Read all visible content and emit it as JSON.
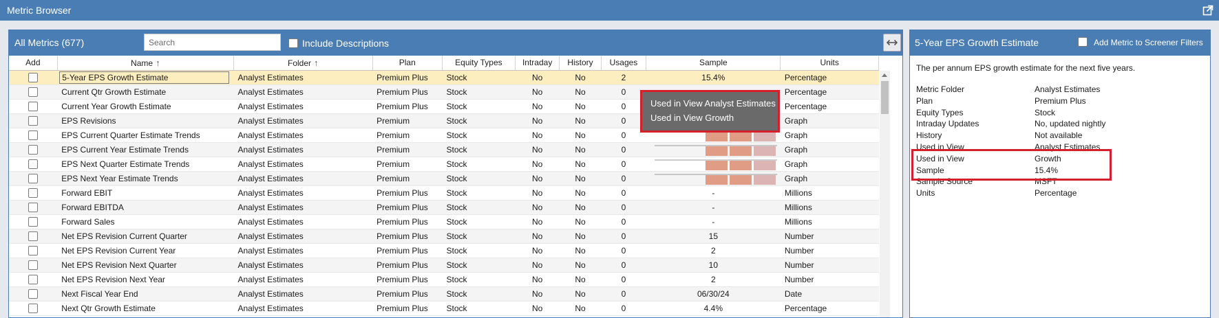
{
  "window": {
    "title": "Metric Browser",
    "popout_icon": "popout-icon"
  },
  "left": {
    "title": "All Metrics (677)",
    "search_placeholder": "Search",
    "include_descriptions": "Include Descriptions",
    "expand_icon": "expand-horizontal-icon",
    "columns": [
      "Add",
      "Name",
      "Folder",
      "Plan",
      "Equity Types",
      "Intraday",
      "History",
      "Usages",
      "Sample",
      "Units"
    ],
    "sort_icon": "sort-up-arrow-icon",
    "rows": [
      {
        "name": "5-Year EPS Growth Estimate",
        "folder": "Analyst Estimates",
        "plan": "Premium Plus",
        "equity": "Stock",
        "intraday": "No",
        "history": "No",
        "usages": "2",
        "sample": "15.4%",
        "units": "Percentage"
      },
      {
        "name": "Current Qtr Growth Estimate",
        "folder": "Analyst Estimates",
        "plan": "Premium Plus",
        "equity": "Stock",
        "intraday": "No",
        "history": "No",
        "usages": "0",
        "sample": "",
        "units": "Percentage"
      },
      {
        "name": "Current Year Growth Estimate",
        "folder": "Analyst Estimates",
        "plan": "Premium Plus",
        "equity": "Stock",
        "intraday": "No",
        "history": "No",
        "usages": "0",
        "sample": "",
        "units": "Percentage"
      },
      {
        "name": "EPS Revisions",
        "folder": "Analyst Estimates",
        "plan": "Premium",
        "equity": "Stock",
        "intraday": "No",
        "history": "No",
        "usages": "0",
        "sample": "",
        "units": "Graph"
      },
      {
        "name": "EPS Current Quarter Estimate Trends",
        "folder": "Analyst Estimates",
        "plan": "Premium",
        "equity": "Stock",
        "intraday": "No",
        "history": "No",
        "usages": "0",
        "sample": "",
        "units": "Graph"
      },
      {
        "name": "EPS Current Year Estimate Trends",
        "folder": "Analyst Estimates",
        "plan": "Premium",
        "equity": "Stock",
        "intraday": "No",
        "history": "No",
        "usages": "0",
        "sample": "",
        "units": "Graph"
      },
      {
        "name": "EPS Next Quarter Estimate Trends",
        "folder": "Analyst Estimates",
        "plan": "Premium",
        "equity": "Stock",
        "intraday": "No",
        "history": "No",
        "usages": "0",
        "sample": "",
        "units": "Graph"
      },
      {
        "name": "EPS Next Year Estimate Trends",
        "folder": "Analyst Estimates",
        "plan": "Premium",
        "equity": "Stock",
        "intraday": "No",
        "history": "No",
        "usages": "0",
        "sample": "",
        "units": "Graph"
      },
      {
        "name": "Forward EBIT",
        "folder": "Analyst Estimates",
        "plan": "Premium Plus",
        "equity": "Stock",
        "intraday": "No",
        "history": "No",
        "usages": "0",
        "sample": "-",
        "units": "Millions"
      },
      {
        "name": "Forward EBITDA",
        "folder": "Analyst Estimates",
        "plan": "Premium Plus",
        "equity": "Stock",
        "intraday": "No",
        "history": "No",
        "usages": "0",
        "sample": "-",
        "units": "Millions"
      },
      {
        "name": "Forward Sales",
        "folder": "Analyst Estimates",
        "plan": "Premium Plus",
        "equity": "Stock",
        "intraday": "No",
        "history": "No",
        "usages": "0",
        "sample": "-",
        "units": "Millions"
      },
      {
        "name": "Net EPS Revision Current Quarter",
        "folder": "Analyst Estimates",
        "plan": "Premium Plus",
        "equity": "Stock",
        "intraday": "No",
        "history": "No",
        "usages": "0",
        "sample": "15",
        "units": "Number"
      },
      {
        "name": "Net EPS Revision Current Year",
        "folder": "Analyst Estimates",
        "plan": "Premium Plus",
        "equity": "Stock",
        "intraday": "No",
        "history": "No",
        "usages": "0",
        "sample": "2",
        "units": "Number"
      },
      {
        "name": "Net EPS Revision Next Quarter",
        "folder": "Analyst Estimates",
        "plan": "Premium Plus",
        "equity": "Stock",
        "intraday": "No",
        "history": "No",
        "usages": "0",
        "sample": "10",
        "units": "Number"
      },
      {
        "name": "Net EPS Revision Next Year",
        "folder": "Analyst Estimates",
        "plan": "Premium Plus",
        "equity": "Stock",
        "intraday": "No",
        "history": "No",
        "usages": "0",
        "sample": "2",
        "units": "Number"
      },
      {
        "name": "Next Fiscal Year End",
        "folder": "Analyst Estimates",
        "plan": "Premium Plus",
        "equity": "Stock",
        "intraday": "No",
        "history": "No",
        "usages": "0",
        "sample": "06/30/24",
        "units": "Date"
      },
      {
        "name": "Next Qtr Growth Estimate",
        "folder": "Analyst Estimates",
        "plan": "Premium Plus",
        "equity": "Stock",
        "intraday": "No",
        "history": "No",
        "usages": "0",
        "sample": "4.4%",
        "units": "Percentage"
      }
    ],
    "spark_colors": [
      "#e09c84",
      "#e09c84",
      "#dcb4b4"
    ]
  },
  "tooltip": {
    "lines": [
      "Used in View Analyst Estimates",
      "Used in View Growth"
    ]
  },
  "right": {
    "title": "5-Year EPS Growth Estimate",
    "add_to_filters": "Add Metric to Screener Filters",
    "description": "The per annum EPS growth estimate for the next five years.",
    "properties": [
      {
        "key": "Metric Folder",
        "value": "Analyst Estimates"
      },
      {
        "key": "Plan",
        "value": "Premium Plus"
      },
      {
        "key": "Equity Types",
        "value": "Stock"
      },
      {
        "key": "Intraday Updates",
        "value": "No, updated nightly"
      },
      {
        "key": "History",
        "value": "Not available"
      },
      {
        "key": "Used in View",
        "value": "Analyst Estimates"
      },
      {
        "key": "Used in View",
        "value": "Growth"
      },
      {
        "key": "Sample",
        "value": "15.4%"
      },
      {
        "key": "Sample Source",
        "value": "MSFT"
      },
      {
        "key": "Units",
        "value": "Percentage"
      }
    ]
  }
}
